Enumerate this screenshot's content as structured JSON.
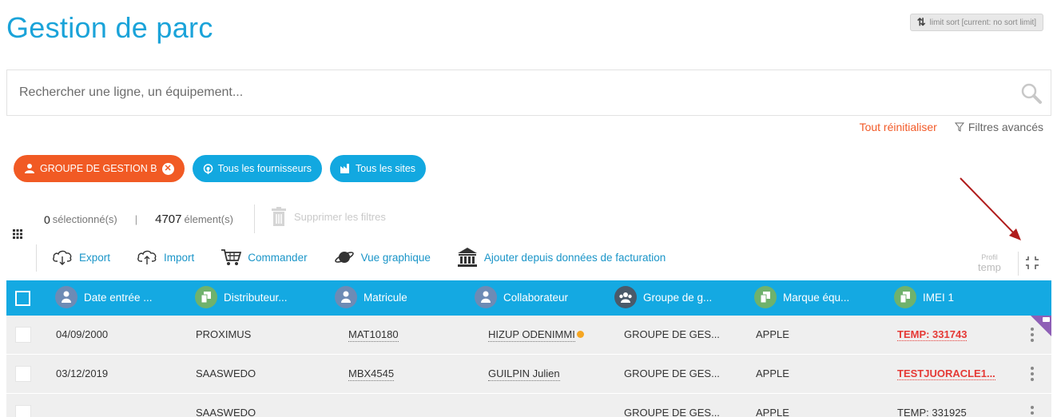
{
  "page": {
    "title": "Gestion de parc"
  },
  "sort_chip": {
    "label": "limit sort [current: no sort limit]",
    "icon": "sort-arrows-icon"
  },
  "search": {
    "placeholder": "Rechercher une ligne, un équipement...",
    "value": "",
    "icon": "magnifier-icon"
  },
  "filters": {
    "reset_label": "Tout réinitialiser",
    "advanced_label": "Filtres avancés",
    "reset_color": "#f25a28"
  },
  "chips": [
    {
      "label": "GROUPE DE GESTION B",
      "icon": "group-person-icon",
      "color": "#f15a24",
      "removable": true
    },
    {
      "label": "Tous les fournisseurs",
      "icon": "antenna-icon",
      "color": "#12a8e0"
    },
    {
      "label": "Tous les sites",
      "icon": "factory-icon",
      "color": "#12a8e0"
    }
  ],
  "selection": {
    "selected_count": "0",
    "selected_label": "sélectionné(s)",
    "separator": "|",
    "total_count": "4707",
    "total_label": "élement(s)",
    "delete_filters_label": "Supprimer les filtres"
  },
  "toolbar": {
    "export": "Export",
    "import": "Import",
    "order": "Commander",
    "chart_view": "Vue graphique",
    "add_billing": "Ajouter depuis données de facturation"
  },
  "profile": {
    "label": "Profil",
    "value": "temp"
  },
  "table": {
    "header_color": "#14a9e2",
    "columns": [
      {
        "label": "Date entrée ...",
        "icon": "person"
      },
      {
        "label": "Distributeur...",
        "icon": "device"
      },
      {
        "label": "Matricule",
        "icon": "person"
      },
      {
        "label": "Collaborateur",
        "icon": "person"
      },
      {
        "label": "Groupe de g...",
        "icon": "group"
      },
      {
        "label": "Marque équ...",
        "icon": "device"
      },
      {
        "label": "IMEI 1",
        "icon": "device"
      }
    ],
    "rows": [
      {
        "date": "04/09/2000",
        "distributor": "PROXIMUS",
        "matricule": "MAT10180",
        "collaborator": "HIZUP ODENIMMI",
        "group": "GROUPE DE GES...",
        "brand": "APPLE",
        "imei": "TEMP: 331743"
      },
      {
        "date": "03/12/2019",
        "distributor": "SAASWEDO",
        "matricule": "MBX4545",
        "collaborator": "GUILPIN Julien",
        "group": "GROUPE DE GES...",
        "brand": "APPLE",
        "imei": "TESTJUORACLE1..."
      },
      {
        "date": "",
        "distributor": "SAASWEDO",
        "matricule": "",
        "collaborator": "",
        "group": "GROUPE DE GES...",
        "brand": "APPLE",
        "imei": "TEMP: 331925"
      }
    ]
  }
}
